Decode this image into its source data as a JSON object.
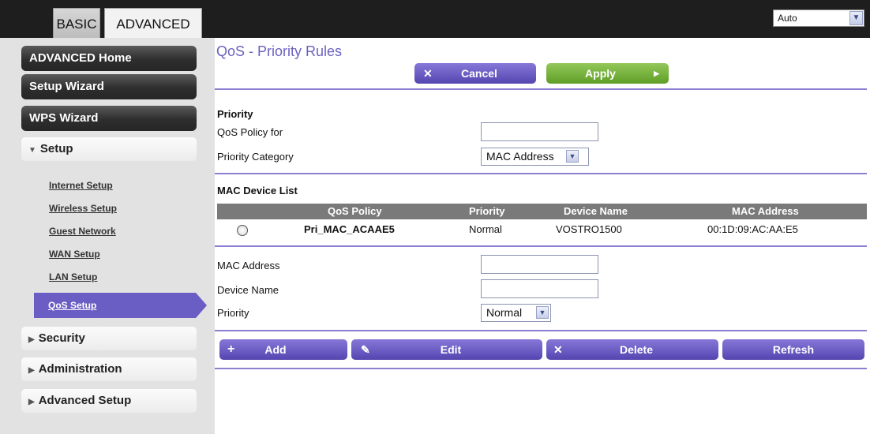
{
  "tabs": {
    "basic": "BASIC",
    "advanced": "ADVANCED"
  },
  "language_select": {
    "value": "Auto"
  },
  "sidebar": {
    "advanced_home": "ADVANCED Home",
    "setup_wizard": "Setup Wizard",
    "wps_wizard": "WPS Wizard",
    "setup": "Setup",
    "setup_items": [
      "Internet Setup",
      "Wireless Setup",
      "Guest Network",
      "WAN Setup",
      "LAN Setup"
    ],
    "qos_setup": "QoS Setup",
    "security": "Security",
    "administration": "Administration",
    "advanced_setup": "Advanced Setup"
  },
  "page": {
    "title": "QoS - Priority Rules",
    "cancel": "Cancel",
    "apply": "Apply"
  },
  "priority_section": {
    "heading": "Priority",
    "policy_label": "QoS Policy for",
    "policy_value": "",
    "category_label": "Priority Category",
    "category_value": "MAC Address"
  },
  "mac_list": {
    "heading": "MAC Device List",
    "columns": [
      "QoS Policy",
      "Priority",
      "Device Name",
      "MAC Address"
    ],
    "rows": [
      {
        "policy": "Pri_MAC_ACAAE5",
        "priority": "Normal",
        "device": "VOSTRO1500",
        "mac": "00:1D:09:AC:AA:E5"
      }
    ]
  },
  "mac_form": {
    "mac_label": "MAC Address",
    "mac_value": "",
    "device_label": "Device Name",
    "device_value": "",
    "priority_label": "Priority",
    "priority_value": "Normal"
  },
  "actions": {
    "add": "Add",
    "edit": "Edit",
    "delete": "Delete",
    "refresh": "Refresh"
  },
  "colors": {
    "accent": "#6a5dc3",
    "apply": "#6fae35",
    "divider": "#8a7fd0"
  }
}
